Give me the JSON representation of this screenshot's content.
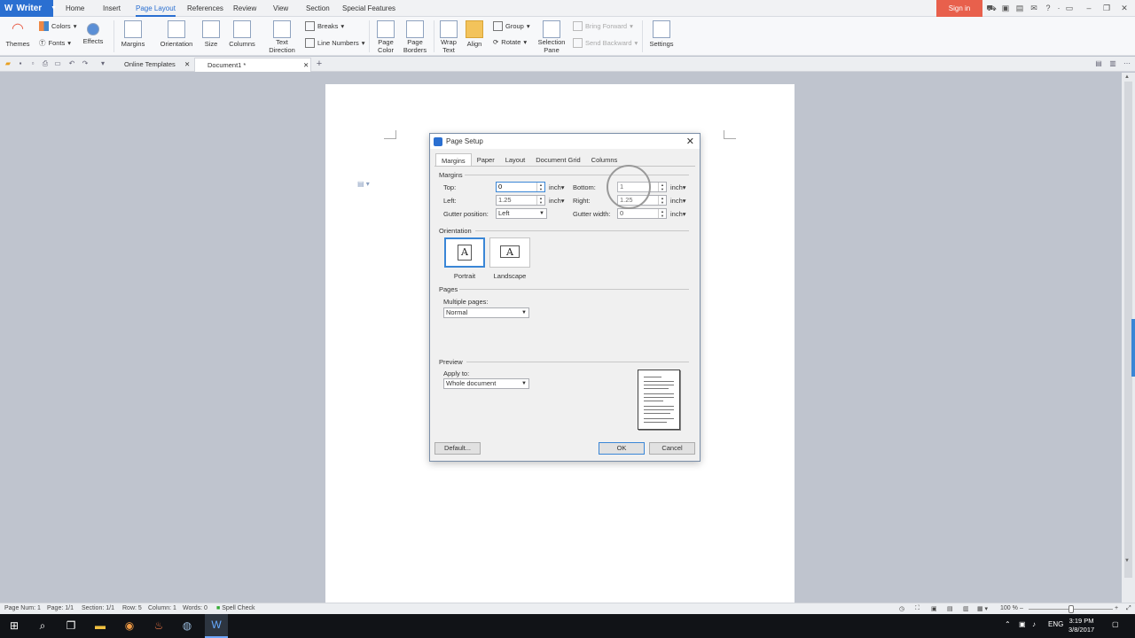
{
  "app": {
    "name": "Writer",
    "sign_in": "Sign in"
  },
  "menu": [
    "Home",
    "Insert",
    "Page Layout",
    "References",
    "Review",
    "View",
    "Section",
    "Special Features"
  ],
  "menu_active": "Page Layout",
  "ribbon": {
    "themes": "Themes",
    "colors": "Colors",
    "fonts": "Fonts",
    "effects": "Effects",
    "margins": "Margins",
    "orientation": "Orientation",
    "size": "Size",
    "columns": "Columns",
    "text_direction_1": "Text",
    "text_direction_2": "Direction",
    "breaks": "Breaks",
    "line_numbers": "Line Numbers",
    "page_color_1": "Page",
    "page_color_2": "Color",
    "page_borders_1": "Page",
    "page_borders_2": "Borders",
    "wrap_text_1": "Wrap",
    "wrap_text_2": "Text",
    "align": "Align",
    "group": "Group",
    "rotate": "Rotate",
    "selection_pane_1": "Selection",
    "selection_pane_2": "Pane",
    "bring_forward": "Bring Forward",
    "send_backward": "Send Backward",
    "settings": "Settings"
  },
  "doc_tabs": {
    "templates": "Online Templates",
    "document": "Document1 *"
  },
  "dialog": {
    "title": "Page Setup",
    "tabs": [
      "Margins",
      "Paper",
      "Layout",
      "Document Grid",
      "Columns"
    ],
    "margins_group": "Margins",
    "top_label": "Top:",
    "top_value": "0",
    "bottom_label": "Bottom:",
    "bottom_value": "1",
    "left_label": "Left:",
    "left_value": "1.25",
    "right_label": "Right:",
    "right_value": "1.25",
    "gutter_pos_label": "Gutter position:",
    "gutter_pos_value": "Left",
    "gutter_width_label": "Gutter width:",
    "gutter_width_value": "0",
    "unit": "inch",
    "orientation_group": "Orientation",
    "portrait": "Portrait",
    "landscape": "Landscape",
    "orientation_glyph": "A",
    "pages_group": "Pages",
    "multiple_pages_label": "Multiple pages:",
    "multiple_pages_value": "Normal",
    "preview_group": "Preview",
    "apply_to_label": "Apply to:",
    "apply_to_value": "Whole document",
    "default_btn": "Default...",
    "ok_btn": "OK",
    "cancel_btn": "Cancel"
  },
  "status": {
    "page_num": "Page Num: 1",
    "page": "Page: 1/1",
    "section": "Section: 1/1",
    "row": "Row: 5",
    "column": "Column: 1",
    "words": "Words: 0",
    "spell": "Spell Check",
    "zoom": "100 %"
  },
  "taskbar": {
    "lang": "ENG",
    "time": "3:19 PM",
    "date": "3/8/2017"
  },
  "colors": {
    "accent": "#2a6fd1",
    "signin": "#e8604c"
  }
}
